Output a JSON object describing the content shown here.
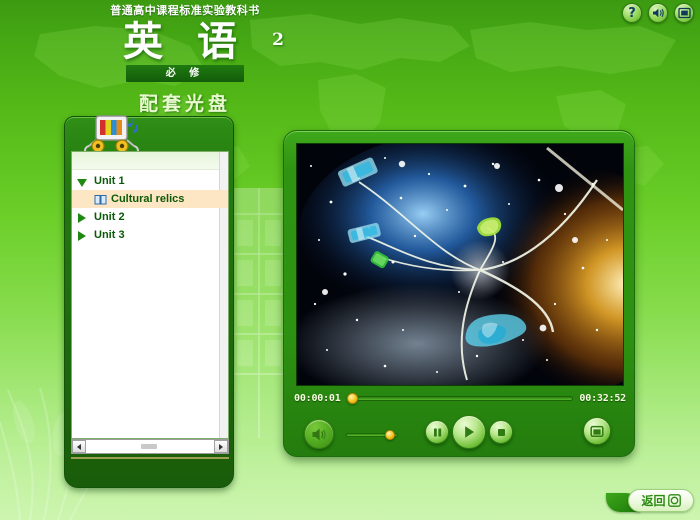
{
  "header": {
    "subject_line": "普通高中课程标准实验教科书",
    "main_title": "英 语",
    "volume_number": "2",
    "requirement_banner": "必 修",
    "disc_line": "配套光盘"
  },
  "window_buttons": [
    {
      "name": "help-button",
      "icon": "question-mark-icon",
      "label": "?"
    },
    {
      "name": "sound-button",
      "icon": "speaker-icon",
      "label": ""
    },
    {
      "name": "window-mode-button",
      "icon": "window-icon",
      "label": ""
    }
  ],
  "nav_panel": {
    "header_icon": "multimedia-tv-icon",
    "tree": [
      {
        "label": "Unit 1",
        "level": 0,
        "state": "expanded",
        "selected": false,
        "icon": "triangle-down-icon"
      },
      {
        "label": "Cultural relics",
        "level": 1,
        "state": "leaf",
        "selected": true,
        "icon": "book-icon"
      },
      {
        "label": "Unit 2",
        "level": 0,
        "state": "collapsed",
        "selected": false,
        "icon": "triangle-right-icon"
      },
      {
        "label": "Unit 3",
        "level": 0,
        "state": "collapsed",
        "selected": false,
        "icon": "triangle-right-icon"
      }
    ],
    "scrollbar": {
      "left_arrow_icon": "arrow-left-icon",
      "right_arrow_icon": "arrow-right-icon"
    }
  },
  "player": {
    "screen_alt": "space nebula video frame",
    "current_time": "00:00:01",
    "total_time": "00:32:52",
    "seek_percent": 2,
    "volume_percent": 86,
    "controls": [
      {
        "name": "pause-button",
        "icon": "pause-icon"
      },
      {
        "name": "play-button",
        "icon": "play-icon"
      },
      {
        "name": "stop-button",
        "icon": "stop-icon"
      },
      {
        "name": "fullscreen-button",
        "icon": "fullscreen-icon"
      },
      {
        "name": "volume-button",
        "icon": "speaker-icon"
      }
    ]
  },
  "footer": {
    "return_label": "返回",
    "return_icon": "return-arrow-icon"
  },
  "colors": {
    "bg_top": "#3c9a11",
    "bg_bottom": "#cdf5b0",
    "panel_green": "#1e6b0c",
    "player_green": "#2d9211",
    "selection_highlight": "#fde6c4",
    "tree_text": "#0a5a08",
    "time_text": "#fbfde0",
    "knob_yellow": "#f2bf18"
  }
}
